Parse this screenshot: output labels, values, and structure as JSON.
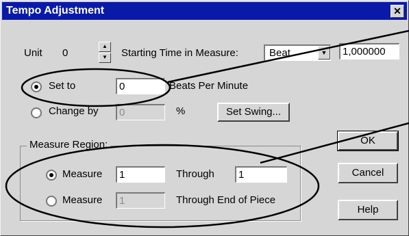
{
  "window": {
    "title": "Tempo Adjustment",
    "close_glyph": "✕"
  },
  "unit": {
    "label": "Unit",
    "value": "0"
  },
  "starting_time": {
    "label": "Starting Time in Measure:",
    "select_value": "Beat",
    "value": "1,000000"
  },
  "set_to": {
    "label": "Set to",
    "value": "0",
    "suffix": "Beats Per Minute",
    "selected": true
  },
  "change_by": {
    "label": "Change by",
    "value": "0",
    "suffix": "%",
    "selected": false
  },
  "set_swing_button": "Set Swing...",
  "measure_region": {
    "title": "Measure Region:",
    "row1": {
      "label": "Measure",
      "from": "1",
      "through_label": "Through",
      "to": "1",
      "selected": true
    },
    "row2": {
      "label": "Measure",
      "from": "1",
      "through_label": "Through End of Piece",
      "selected": false
    }
  },
  "buttons": {
    "ok": "OK",
    "cancel": "Cancel",
    "help": "Help"
  }
}
